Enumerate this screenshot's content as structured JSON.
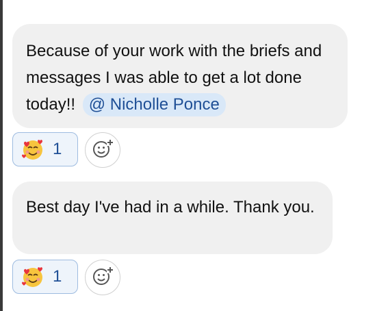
{
  "messages": [
    {
      "text": "Because of your work with the briefs and messages I was able to get a lot done today!!",
      "mention": "@ Nicholle Ponce",
      "reaction": {
        "emoji": "smiling-face-with-hearts",
        "count": "1"
      }
    },
    {
      "text": "Best day I've had in a while. Thank you.",
      "reaction": {
        "emoji": "smiling-face-with-hearts",
        "count": "1"
      }
    }
  ],
  "colors": {
    "bubble": "#f0f0f0",
    "mention_bg": "#d9e8f8",
    "mention_text": "#1f4f96",
    "reaction_border": "#9dbbe0",
    "reaction_bg": "#eef4fb"
  },
  "icons": {
    "add_reaction": "add-reaction-icon"
  }
}
